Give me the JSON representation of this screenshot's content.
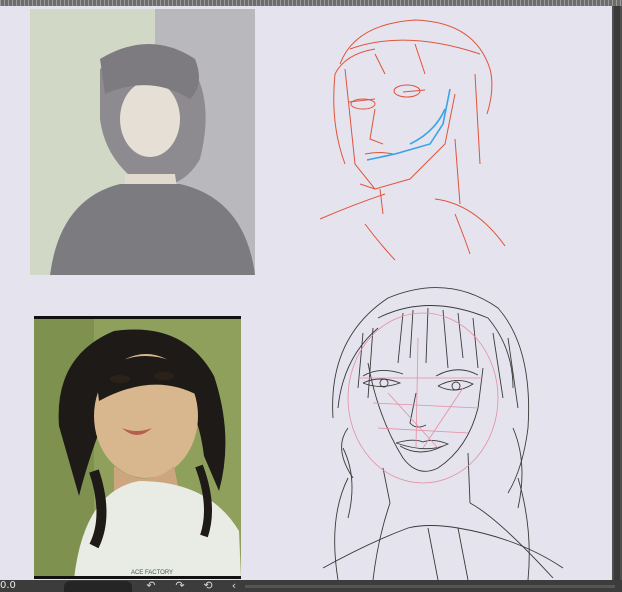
{
  "canvas": {
    "background": "#e4e3ee"
  },
  "photos": [
    {
      "name": "reference-photo-top",
      "tint": "#d2d8c6"
    },
    {
      "name": "reference-photo-bottom",
      "tint": "#8fa05c",
      "shirt_text": "ACE FACTORY"
    }
  ],
  "sketches": [
    {
      "name": "construction-sketch",
      "stroke_colors": [
        "#e0543c",
        "#3aa3e8"
      ]
    },
    {
      "name": "lineart-sketch",
      "stroke_colors": [
        "#3a3a3a",
        "#e58fa3"
      ]
    }
  ],
  "bottombar": {
    "zoom_label": "0.0",
    "tools": [
      {
        "name": "rotate-left-icon",
        "glyph": "↶"
      },
      {
        "name": "rotate-right-icon",
        "glyph": "↷"
      },
      {
        "name": "reset-rotation-icon",
        "glyph": "⟲"
      },
      {
        "name": "chevron-left-icon",
        "glyph": "‹"
      }
    ]
  }
}
